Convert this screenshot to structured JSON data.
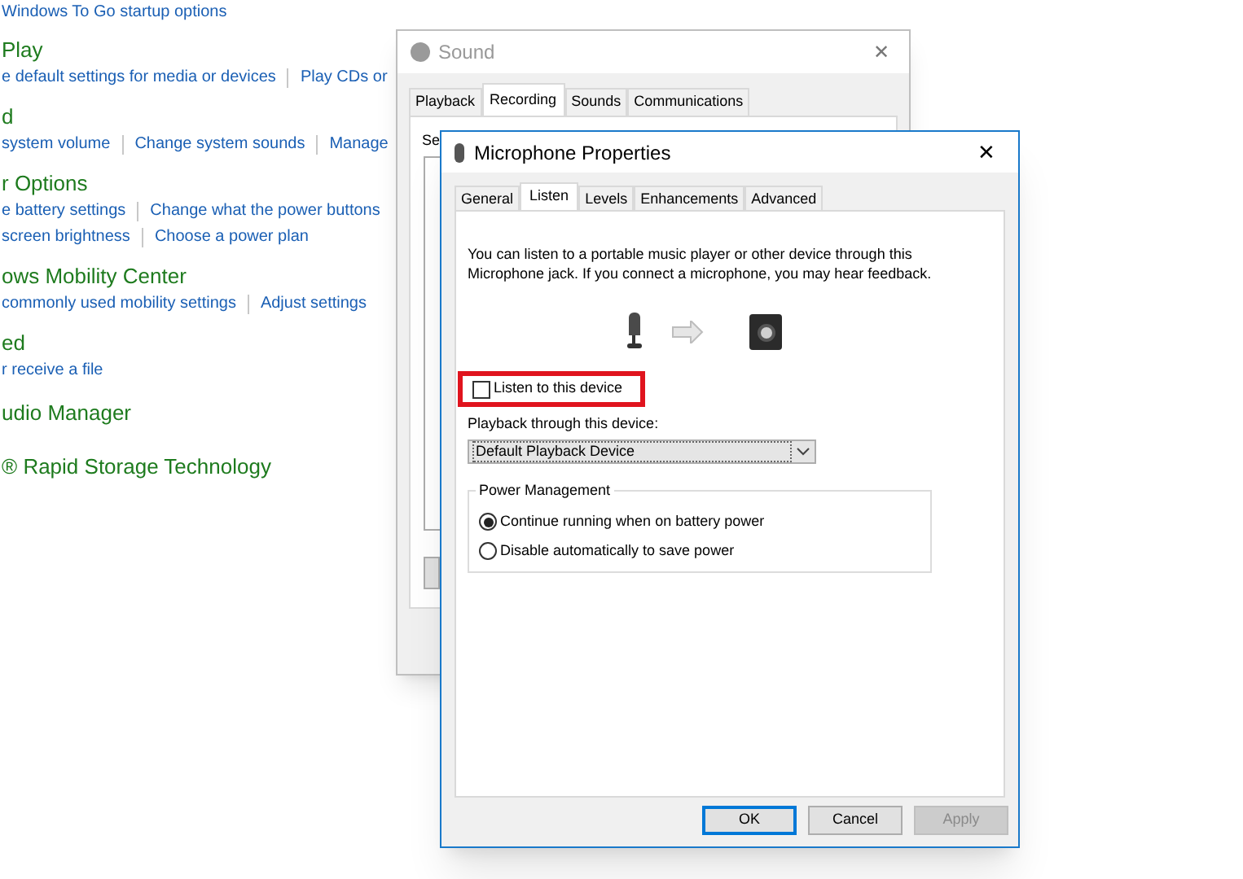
{
  "control_panel": {
    "sections": [
      {
        "links": [
          "Windows To Go startup options"
        ]
      },
      {
        "heading": "Play",
        "links": [
          "e default settings for media or devices",
          "Play CDs or"
        ]
      },
      {
        "heading": "d",
        "links": [
          "system volume",
          "Change system sounds",
          "Manage"
        ]
      },
      {
        "heading": "r Options",
        "links": [
          "e battery settings",
          "Change what the power buttons"
        ],
        "links_2": [
          "screen brightness",
          "Choose a power plan"
        ]
      },
      {
        "heading": "ows Mobility Center",
        "links": [
          "commonly used mobility settings",
          "Adjust settings"
        ]
      },
      {
        "heading": "ed",
        "links": [
          "r receive a file"
        ]
      },
      {
        "heading": "udio Manager"
      },
      {
        "heading": "® Rapid Storage Technology"
      }
    ]
  },
  "sound_window": {
    "title": "Sound",
    "close": "✕",
    "tabs": [
      {
        "label": "Playback",
        "selected": false
      },
      {
        "label": "Recording",
        "selected": true
      },
      {
        "label": "Sounds",
        "selected": false
      },
      {
        "label": "Communications",
        "selected": false
      }
    ],
    "text": "Se"
  },
  "properties_window": {
    "title": "Microphone Properties",
    "close": "✕",
    "tabs": [
      {
        "label": "General",
        "selected": false
      },
      {
        "label": "Listen",
        "selected": true
      },
      {
        "label": "Levels",
        "selected": false
      },
      {
        "label": "Enhancements",
        "selected": false
      },
      {
        "label": "Advanced",
        "selected": false
      }
    ],
    "description": "You can listen to a portable music player or other device through this Microphone jack.  If you connect a microphone, you may hear feedback.",
    "listen_checkbox": {
      "label": "Listen to this device",
      "checked": false,
      "highlighted": true
    },
    "playback_label": "Playback through this device:",
    "playback_dropdown": {
      "value": "Default Playback Device"
    },
    "power_group": {
      "title": "Power Management",
      "options": [
        {
          "label": "Continue running when on battery power",
          "selected": true
        },
        {
          "label": "Disable automatically to save power",
          "selected": false
        }
      ]
    },
    "buttons": [
      {
        "label": "OK",
        "disabled": false,
        "default": true
      },
      {
        "label": "Cancel",
        "disabled": false,
        "default": false
      },
      {
        "label": "Apply",
        "disabled": true,
        "default": false
      }
    ]
  }
}
